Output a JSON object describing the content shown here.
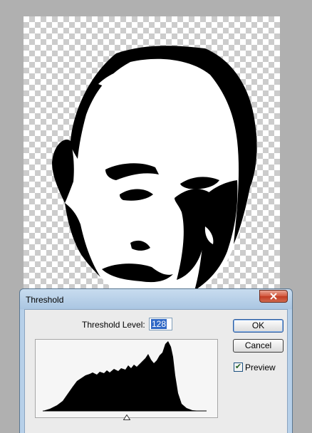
{
  "dialog": {
    "title": "Threshold",
    "threshold_label": "Threshold Level:",
    "threshold_value": "128",
    "ok_label": "OK",
    "cancel_label": "Cancel",
    "preview_label": "Preview",
    "preview_checked": true
  },
  "icons": {
    "close": "close-x-icon",
    "check": "checkmark-icon",
    "slider": "triangle-up-icon"
  },
  "colors": {
    "title_bar": "#aac6e2",
    "close_button": "#c23b22",
    "selection": "#3169c6"
  }
}
